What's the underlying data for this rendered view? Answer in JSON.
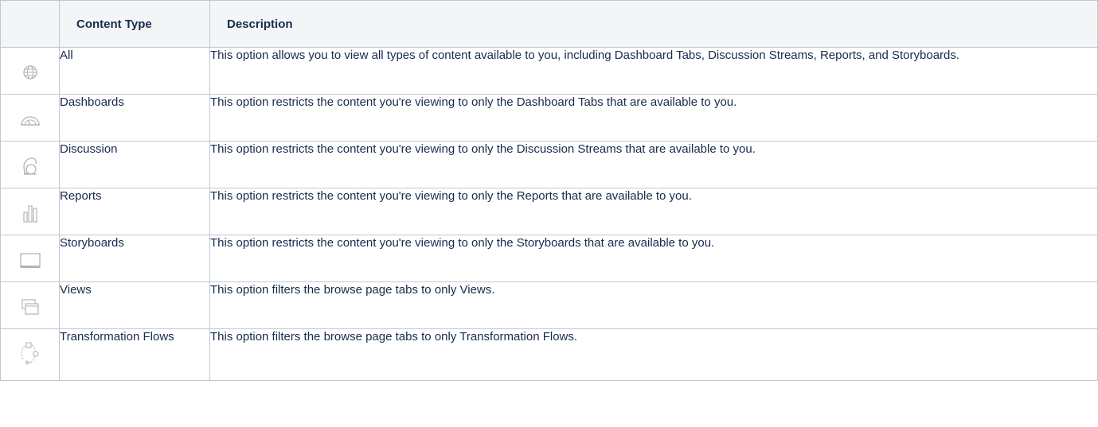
{
  "table": {
    "headers": {
      "icon": "",
      "type": "Content Type",
      "description": "Description"
    },
    "rows": [
      {
        "icon": "globe-icon",
        "type": "All",
        "description": "This option allows you to view all types of content available to you, including Dashboard Tabs, Discussion Streams, Reports, and Storyboards."
      },
      {
        "icon": "dashboard-gauge-icon",
        "type": "Dashboards",
        "description": "This option restricts the content you're viewing to only the Dashboard Tabs that are available to you."
      },
      {
        "icon": "discussion-icon",
        "type": "Discussion",
        "description": "This option restricts the content you're viewing to only the Discussion Streams that are available to you."
      },
      {
        "icon": "bar-chart-icon",
        "type": "Reports",
        "description": "This option restricts the content you're viewing to only the Reports that are available to you."
      },
      {
        "icon": "storyboard-icon",
        "type": "Storyboards",
        "description": "This option restricts the content you're viewing to only the Storyboards that are available to you."
      },
      {
        "icon": "views-icon",
        "type": "Views",
        "description": "This option filters the browse page tabs to only Views."
      },
      {
        "icon": "transformation-flow-icon",
        "type": "Transformation Flows",
        "description": "This option filters the browse page tabs to only Transformation Flows."
      }
    ],
    "colors": {
      "border": "#c1c7d0",
      "header_bg": "#f4f5f7",
      "text": "#172b4d",
      "icon": "#b3b3b3"
    }
  }
}
